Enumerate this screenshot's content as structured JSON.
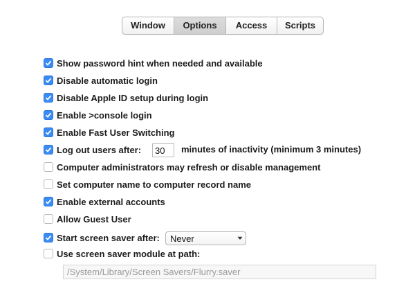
{
  "tabs": [
    {
      "label": "Window",
      "active": false
    },
    {
      "label": "Options",
      "active": true
    },
    {
      "label": "Access",
      "active": false
    },
    {
      "label": "Scripts",
      "active": false
    }
  ],
  "options": [
    {
      "label": "Show password hint when needed and available",
      "checked": true
    },
    {
      "label": "Disable automatic login",
      "checked": true
    },
    {
      "label": "Disable Apple ID setup during login",
      "checked": true
    },
    {
      "label": "Enable >console login",
      "checked": true
    },
    {
      "label": "Enable Fast User Switching",
      "checked": true
    },
    {
      "label": "Log out users after:",
      "checked": true
    },
    {
      "label": "Computer administrators may refresh or disable management",
      "checked": false
    },
    {
      "label": "Set computer name to computer record name",
      "checked": false
    },
    {
      "label": "Enable external accounts",
      "checked": true
    },
    {
      "label": "Allow Guest User",
      "checked": false
    },
    {
      "label": "Start screen saver after:",
      "checked": true
    },
    {
      "label": "Use screen saver module at path:",
      "checked": false
    }
  ],
  "logout": {
    "minutes": "30",
    "suffix": "minutes of inactivity (minimum 3 minutes)"
  },
  "screensaver": {
    "selected": "Never"
  },
  "module_path": "/System/Library/Screen Savers/Flurry.saver",
  "colors": {
    "checkbox_on": "#3b8bf5"
  }
}
